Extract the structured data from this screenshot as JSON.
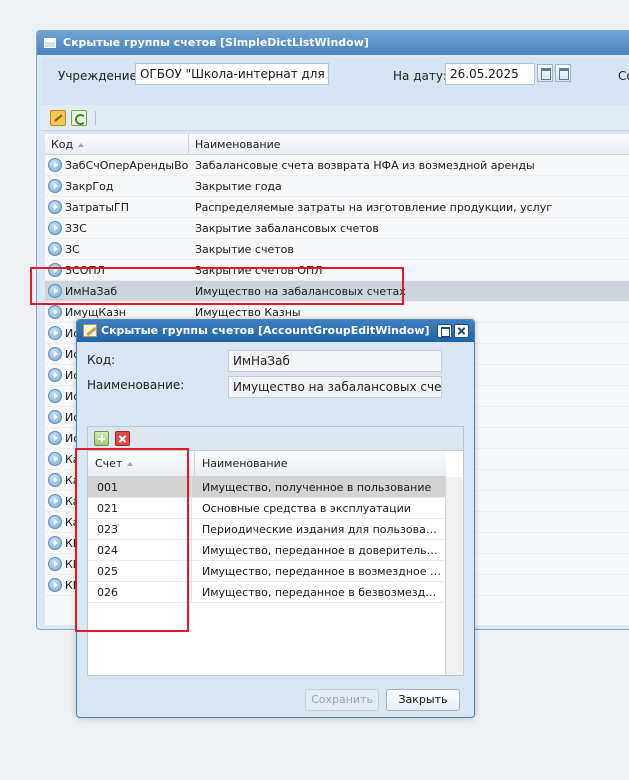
{
  "main_window": {
    "title": "Скрытые группы счетов [SimpleDictListWindow]",
    "filter": {
      "institution_label": "Учреждение:",
      "institution_value": "ОГБОУ \"Школа-интернат для обу",
      "date_label": "На дату:",
      "date_value": "26.05.2025",
      "extra_label": "Со"
    },
    "grid": {
      "headers": {
        "code": "Код",
        "name": "Наименование"
      },
      "rows": [
        {
          "code": "ЗабСчОперАрендыВозм",
          "name": "Забалансовые счета возврата НФА из возмездной аренды"
        },
        {
          "code": "ЗакрГод",
          "name": "Закрытие года"
        },
        {
          "code": "ЗатратыГП",
          "name": "Распределяемые затраты на изготовление продукции, услуг"
        },
        {
          "code": "ЗЗС",
          "name": "Закрытие забалансовых счетов"
        },
        {
          "code": "ЗС",
          "name": "Закрытие счетов"
        },
        {
          "code": "ЗСОПЛ",
          "name": "Закрытие счетов ОПЛ"
        },
        {
          "code": "ИмНаЗаб",
          "name": "Имущество на забалансовых счетах"
        },
        {
          "code": "ИмущКазн",
          "name": "Имущество Казны"
        },
        {
          "code": "Ис",
          "name": ""
        },
        {
          "code": "Ис",
          "name": ""
        },
        {
          "code": "Ис",
          "name": ""
        },
        {
          "code": "Ис",
          "name": ""
        },
        {
          "code": "Ис",
          "name": "ет)"
        },
        {
          "code": "Ис",
          "name": "дит)"
        },
        {
          "code": "Ка",
          "name": ""
        },
        {
          "code": "Ка",
          "name": ""
        },
        {
          "code": "Ка",
          "name": ""
        },
        {
          "code": "Ка",
          "name": ""
        },
        {
          "code": "КБ",
          "name": ""
        },
        {
          "code": "КБ",
          "name": ""
        },
        {
          "code": "КБ",
          "name": ""
        }
      ]
    }
  },
  "dialog": {
    "title": "Скрытые группы счетов [AccountGroupEditWindow]",
    "code_label": "Код:",
    "code_value": "ИмНаЗаб",
    "name_label": "Наименование:",
    "name_value": "Имущество на забалансовых счетах",
    "grid": {
      "headers": {
        "account": "Счет",
        "name": "Наименование"
      },
      "rows": [
        {
          "account": "001",
          "name": "Имущество, полученное в пользование"
        },
        {
          "account": "021",
          "name": "Основные средства в эксплуатации"
        },
        {
          "account": "023",
          "name": "Периодические издания для пользования"
        },
        {
          "account": "024",
          "name": "Имущество, переданное в доверительное уп..."
        },
        {
          "account": "025",
          "name": "Имущество, переданное в возмездное польз..."
        },
        {
          "account": "026",
          "name": "Имущество, переданное в безвозмездное по..."
        }
      ]
    },
    "save_label": "Сохранить",
    "close_label": "Закрыть"
  },
  "colors": {
    "highlight": "#e0192b",
    "title_bar": "#2a6fb3",
    "selected_row": "#ccd4de"
  }
}
